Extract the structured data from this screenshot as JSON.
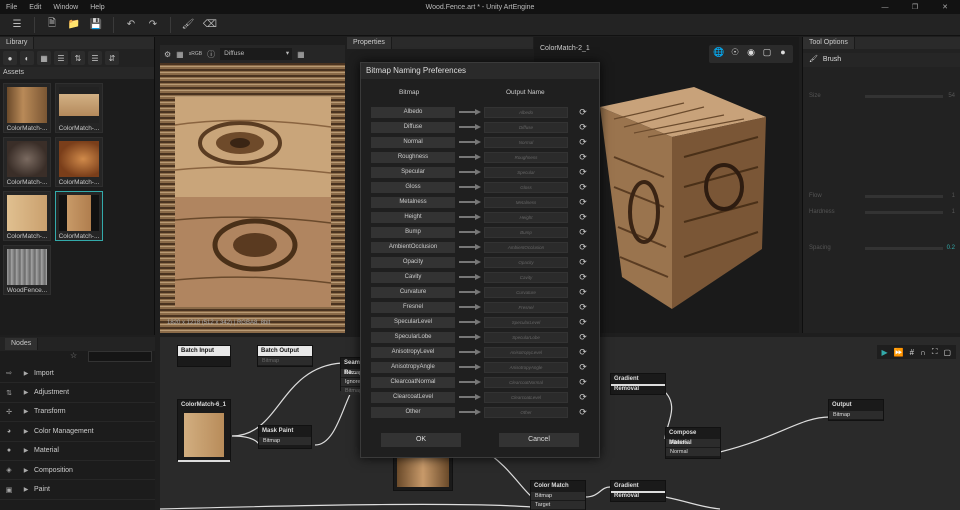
{
  "window": {
    "title": "Wood.Fence.art * - Unity ArtEngine",
    "menu": [
      "File",
      "Edit",
      "Window",
      "Help"
    ]
  },
  "library": {
    "tab": "Library",
    "assets_header": "Assets",
    "assets": [
      {
        "label": "ColorMatch-..."
      },
      {
        "label": "ColorMatch-..."
      },
      {
        "label": "ColorMatch-..."
      },
      {
        "label": "ColorMatch-..."
      },
      {
        "label": "ColorMatch-..."
      },
      {
        "label": "ColorMatch-..."
      },
      {
        "label": "WoodFence..."
      }
    ]
  },
  "viewer2d": {
    "channel_tag": "sRGB",
    "channel": "Diffuse",
    "info": "1820 x 1218 (512 x 342) | RGBA8, 8bit"
  },
  "properties": {
    "tab": "Properties"
  },
  "viewer3d": {
    "title": "ColorMatch-2_1"
  },
  "tool_options": {
    "tab": "Tool Options",
    "tool": "Brush",
    "rows": [
      {
        "label": "Size",
        "value": "54"
      },
      {
        "label": "Flow",
        "value": "1"
      },
      {
        "label": "Hardness",
        "value": "1"
      },
      {
        "label": "Spacing",
        "value": "0.2"
      }
    ]
  },
  "nodes_panel": {
    "tab": "Nodes",
    "categories": [
      "Import",
      "Adjustment",
      "Transform",
      "Color Management",
      "Material",
      "Composition",
      "Paint"
    ]
  },
  "graph": {
    "nodes": {
      "batch_input": {
        "title": "Batch Input"
      },
      "batch_output": {
        "title": "Batch Output",
        "port": "Bitmap"
      },
      "seam_removal": {
        "title": "Seam Re...",
        "ports": [
          "Bitmap",
          "Ignore",
          "Bitmap"
        ]
      },
      "colormatch": {
        "title": "ColorMatch-6_1"
      },
      "mask_paint": {
        "title": "Mask Paint",
        "port": "Bitmap"
      },
      "gradient_removal_1": {
        "title": "Gradient Removal"
      },
      "output": {
        "title": "Output",
        "port": "Bitmap"
      },
      "compose_material": {
        "title": "Compose Material",
        "ports": [
          "Albedo",
          "Normal"
        ]
      },
      "color_match": {
        "title": "Color Match",
        "ports": [
          "Bitmap",
          "Target"
        ]
      },
      "gradient_removal_2": {
        "title": "Gradient Removal"
      }
    }
  },
  "dialog": {
    "title": "Bitmap Naming Preferences",
    "col_bitmap": "Bitmap",
    "col_output": "Output Name",
    "rows": [
      {
        "bitmap": "Albedo",
        "output": "Albedo"
      },
      {
        "bitmap": "Diffuse",
        "output": "Diffuse"
      },
      {
        "bitmap": "Normal",
        "output": "Normal"
      },
      {
        "bitmap": "Roughness",
        "output": "Roughness"
      },
      {
        "bitmap": "Specular",
        "output": "Specular"
      },
      {
        "bitmap": "Gloss",
        "output": "Gloss"
      },
      {
        "bitmap": "Metalness",
        "output": "Metalness"
      },
      {
        "bitmap": "Height",
        "output": "Height"
      },
      {
        "bitmap": "Bump",
        "output": "Bump"
      },
      {
        "bitmap": "AmbientOcclusion",
        "output": "AmbientOcclusion"
      },
      {
        "bitmap": "Opacity",
        "output": "Opacity"
      },
      {
        "bitmap": "Cavity",
        "output": "Cavity"
      },
      {
        "bitmap": "Curvature",
        "output": "Curvature"
      },
      {
        "bitmap": "Fresnel",
        "output": "Fresnel"
      },
      {
        "bitmap": "SpecularLevel",
        "output": "SpecularLevel"
      },
      {
        "bitmap": "SpecularLobe",
        "output": "SpecularLobe"
      },
      {
        "bitmap": "AnisotropyLevel",
        "output": "AnisotropyLevel"
      },
      {
        "bitmap": "AnisotropyAngle",
        "output": "AnisotropyAngle"
      },
      {
        "bitmap": "ClearcoatNormal",
        "output": "ClearcoatNormal"
      },
      {
        "bitmap": "ClearcoatLevel",
        "output": "ClearcoatLevel"
      },
      {
        "bitmap": "Other",
        "output": "Other"
      }
    ],
    "ok_label": "OK",
    "cancel_label": "Cancel"
  },
  "colors": {
    "accent": "#33aaaa",
    "wood_light": "#c8a47a",
    "wood_dark": "#5a3e24",
    "dialog_bg": "#1f1f1f"
  }
}
